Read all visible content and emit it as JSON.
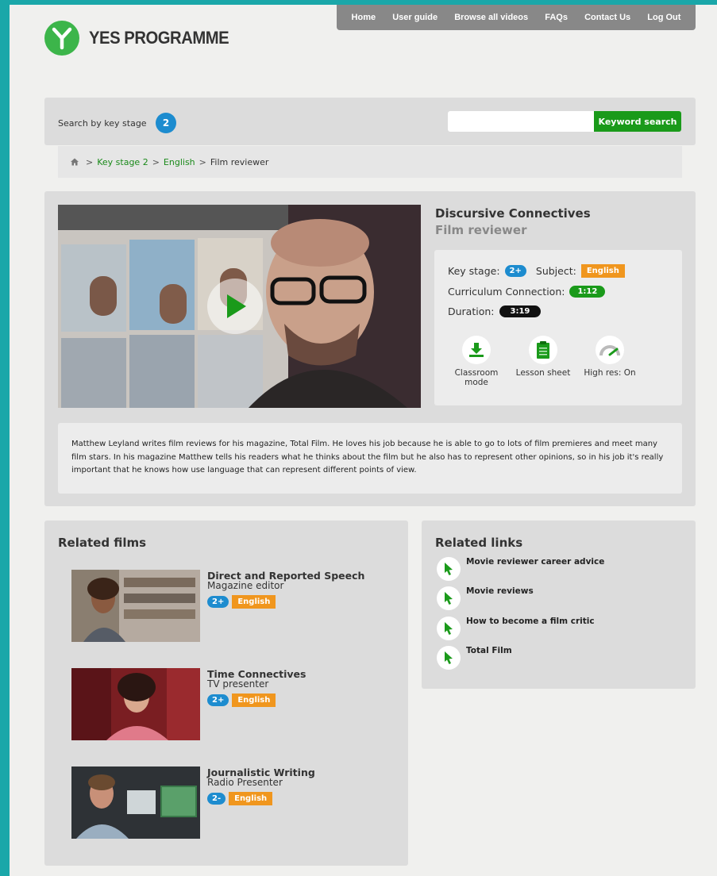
{
  "nav": {
    "items": [
      "Home",
      "User guide",
      "Browse all videos",
      "FAQs",
      "Contact Us",
      "Log Out"
    ]
  },
  "logo": {
    "text": "YES PROGRAMME"
  },
  "search": {
    "label": "Search by key stage",
    "key_stage": "2",
    "placeholder": "",
    "button": "Keyword search"
  },
  "breadcrumb": {
    "items": [
      "Key stage 2",
      "English"
    ],
    "current": "Film reviewer",
    "separator": ">"
  },
  "video": {
    "title": "Discursive Connectives",
    "subtitle": "Film reviewer",
    "key_stage_label": "Key stage:",
    "key_stage": "2+",
    "subject_label": "Subject:",
    "subject": "English",
    "curriculum_label": "Curriculum Connection:",
    "curriculum": "1:12",
    "duration_label": "Duration:",
    "duration": "3:19",
    "tools": [
      {
        "label": "Classroom mode",
        "icon": "download-icon"
      },
      {
        "label": "Lesson sheet",
        "icon": "clipboard-icon"
      },
      {
        "label": "High res: On",
        "icon": "speedometer-icon"
      }
    ],
    "description": "Matthew Leyland writes film reviews for his magazine, Total Film. He loves his job because he is able to go to lots of film premieres and meet many film stars. In his magazine Matthew tells his readers what he thinks about the film but he also has to represent other opinions, so in his job it's really important that he knows how use language that can represent different points of view."
  },
  "related_films": {
    "title": "Related films",
    "items": [
      {
        "title": "Direct and Reported Speech",
        "role": "Magazine editor",
        "stage": "2+",
        "subject": "English"
      },
      {
        "title": "Time Connectives",
        "role": "TV presenter",
        "stage": "2+",
        "subject": "English"
      },
      {
        "title": "Journalistic Writing",
        "role": "Radio Presenter",
        "stage": "2-",
        "subject": "English"
      }
    ]
  },
  "related_links": {
    "title": "Related links",
    "items": [
      "Movie reviewer career advice",
      "Movie reviews",
      "How to become a film critic",
      "Total Film"
    ]
  },
  "colors": {
    "teal_border": "#1aa7a9",
    "green": "#1a9a1a",
    "blue": "#1d8ccf",
    "orange": "#f0961e"
  }
}
